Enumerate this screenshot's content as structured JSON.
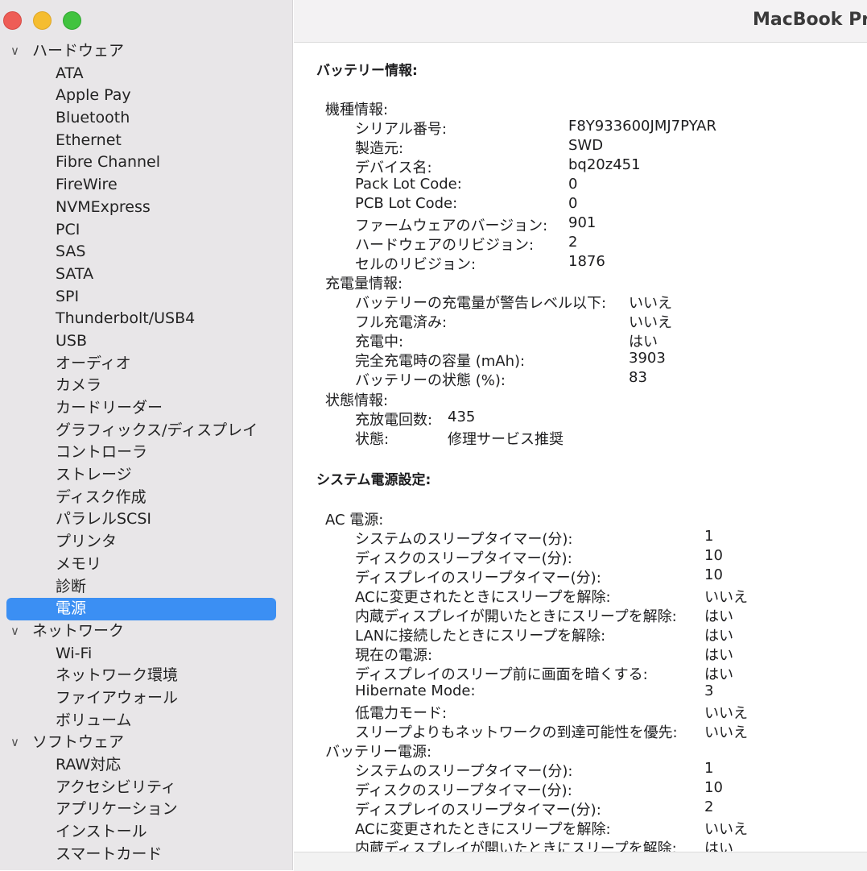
{
  "window": {
    "title": "MacBook Pr"
  },
  "sidebar": {
    "groups": [
      {
        "label": "ハードウェア",
        "items": [
          "ATA",
          "Apple Pay",
          "Bluetooth",
          "Ethernet",
          "Fibre Channel",
          "FireWire",
          "NVMExpress",
          "PCI",
          "SAS",
          "SATA",
          "SPI",
          "Thunderbolt/USB4",
          "USB",
          "オーディオ",
          "カメラ",
          "カードリーダー",
          "グラフィックス/ディスプレイ",
          "コントローラ",
          "ストレージ",
          "ディスク作成",
          "パラレルSCSI",
          "プリンタ",
          "メモリ",
          "診断",
          "電源"
        ]
      },
      {
        "label": "ネットワーク",
        "items": [
          "Wi-Fi",
          "ネットワーク環境",
          "ファイアウォール",
          "ボリューム"
        ]
      },
      {
        "label": "ソフトウェア",
        "items": [
          "RAW対応",
          "アクセシビリティ",
          "アプリケーション",
          "インストール",
          "スマートカード"
        ]
      }
    ],
    "selected": "電源"
  },
  "battery": {
    "title": "バッテリー情報:",
    "model_header": "機種情報:",
    "model": [
      {
        "k": "シリアル番号:",
        "v": "F8Y933600JMJ7PYAR"
      },
      {
        "k": "製造元:",
        "v": "SWD"
      },
      {
        "k": "デバイス名:",
        "v": "bq20z451"
      },
      {
        "k": "Pack Lot Code:",
        "v": "0"
      },
      {
        "k": "PCB Lot Code:",
        "v": "0"
      },
      {
        "k": "ファームウェアのバージョン:",
        "v": "901"
      },
      {
        "k": "ハードウェアのリビジョン:",
        "v": "2"
      },
      {
        "k": "セルのリビジョン:",
        "v": "1876"
      }
    ],
    "charge_header": "充電量情報:",
    "charge": [
      {
        "k": "バッテリーの充電量が警告レベル以下:",
        "v": "いいえ"
      },
      {
        "k": "フル充電済み:",
        "v": "いいえ"
      },
      {
        "k": "充電中:",
        "v": "はい"
      },
      {
        "k": "完全充電時の容量 (mAh):",
        "v": "3903"
      },
      {
        "k": "バッテリーの状態 (%):",
        "v": "83"
      }
    ],
    "status_header": "状態情報:",
    "status": [
      {
        "k": "充放電回数:",
        "v": "435"
      },
      {
        "k": "状態:",
        "v": "修理サービス推奨"
      }
    ]
  },
  "power": {
    "title": "システム電源設定:",
    "ac_header": "AC 電源:",
    "ac": [
      {
        "k": "システムのスリープタイマー(分):",
        "v": "1"
      },
      {
        "k": "ディスクのスリープタイマー(分):",
        "v": "10"
      },
      {
        "k": "ディスプレイのスリープタイマー(分):",
        "v": "10"
      },
      {
        "k": "ACに変更されたときにスリープを解除:",
        "v": "いいえ"
      },
      {
        "k": "内蔵ディスプレイが開いたときにスリープを解除:",
        "v": "はい"
      },
      {
        "k": "LANに接続したときにスリープを解除:",
        "v": "はい"
      },
      {
        "k": "現在の電源:",
        "v": "はい"
      },
      {
        "k": "ディスプレイのスリープ前に画面を暗くする:",
        "v": "はい"
      },
      {
        "k": "Hibernate Mode:",
        "v": "3"
      },
      {
        "k": "低電力モード:",
        "v": "いいえ"
      },
      {
        "k": "スリープよりもネットワークの到達可能性を優先:",
        "v": "いいえ"
      }
    ],
    "batt_header": "バッテリー電源:",
    "batt": [
      {
        "k": "システムのスリープタイマー(分):",
        "v": "1"
      },
      {
        "k": "ディスクのスリープタイマー(分):",
        "v": "10"
      },
      {
        "k": "ディスプレイのスリープタイマー(分):",
        "v": "2"
      },
      {
        "k": "ACに変更されたときにスリープを解除:",
        "v": "いいえ"
      },
      {
        "k": "内蔵ディスプレイが開いたときにスリープを解除:",
        "v": "はい"
      }
    ]
  },
  "footer": {
    "path": ""
  }
}
